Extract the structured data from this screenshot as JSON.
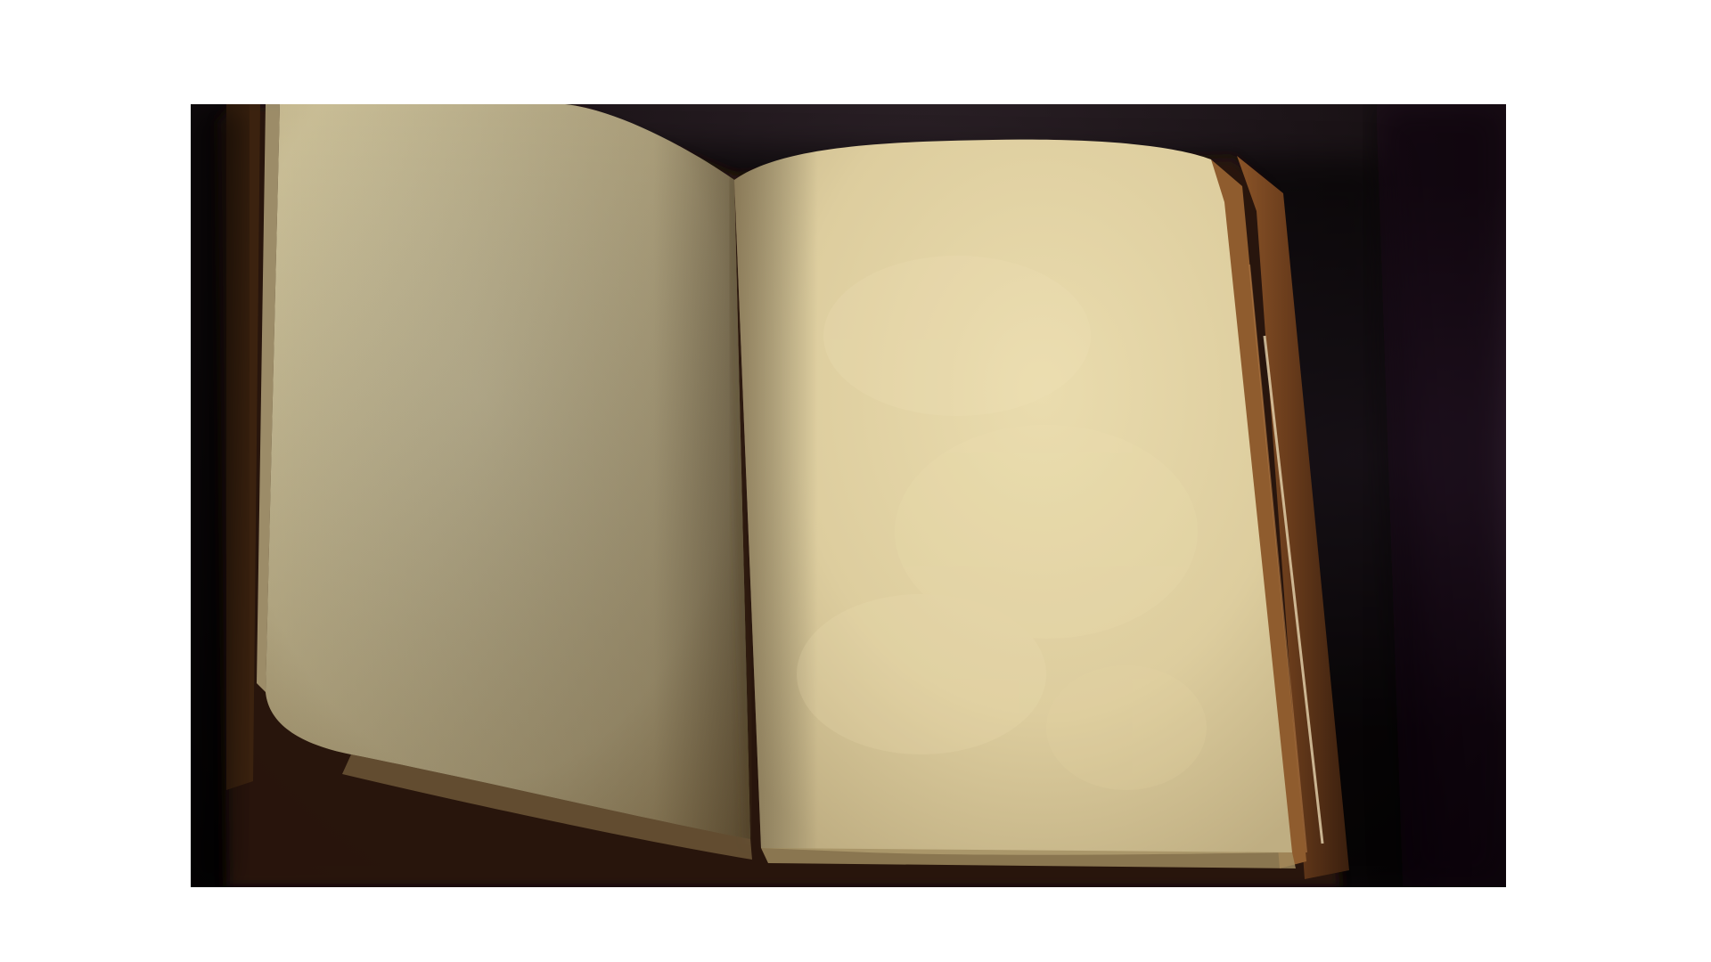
{
  "scene": {
    "colors": {
      "background_dark": "#120c0f",
      "leather_cover": "#6b3d1c",
      "leather_dark": "#3a1f0e",
      "page_left": "#d6cba4",
      "page_right": "#e2d4a6",
      "page_edge": "#b7a57c"
    }
  }
}
